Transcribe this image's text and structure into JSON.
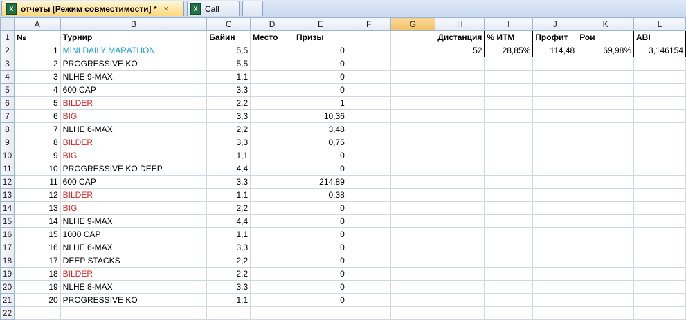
{
  "tabs": [
    {
      "label": "отчеты  [Режим совместимости] *",
      "close": "×",
      "icon": "excel-file-icon"
    },
    {
      "label": "Call",
      "icon": "excel-file-icon"
    },
    {
      "label": ""
    }
  ],
  "columns": [
    "A",
    "B",
    "C",
    "D",
    "E",
    "F",
    "G",
    "H",
    "I",
    "J",
    "K",
    "L"
  ],
  "row_numbers": [
    "1",
    "2",
    "3",
    "4",
    "5",
    "6",
    "7",
    "8",
    "9",
    "10",
    "11",
    "12",
    "13",
    "14",
    "15",
    "16",
    "17",
    "18",
    "19",
    "20",
    "21",
    "22"
  ],
  "header_row": {
    "A": "№",
    "B": "Турнир",
    "C": "Байин",
    "D": "Место",
    "E": "Призы",
    "H": "Дистанция",
    "I": "% ИТМ",
    "J": "Профит",
    "K": "Рои",
    "L": "ABI"
  },
  "stats": {
    "H": "52",
    "I": "28,85%",
    "J": "114,48",
    "K": "69,98%",
    "L": "3,146154"
  },
  "rows": [
    {
      "a": "1",
      "b": "MINI DAILY MARATHON",
      "c": "5,5",
      "d": "",
      "e": "0",
      "color": "blue"
    },
    {
      "a": "2",
      "b": "PROGRESSIVE KO",
      "c": "5,5",
      "d": "",
      "e": "0",
      "color": ""
    },
    {
      "a": "3",
      "b": "NLHE 9-MAX",
      "c": "1,1",
      "d": "",
      "e": "0",
      "color": ""
    },
    {
      "a": "4",
      "b": "600 CAP",
      "c": "3,3",
      "d": "",
      "e": "0",
      "color": ""
    },
    {
      "a": "5",
      "b": "BILDER",
      "c": "2,2",
      "d": "",
      "e": "1",
      "color": "red"
    },
    {
      "a": "6",
      "b": "BIG",
      "c": "3,3",
      "d": "",
      "e": "10,36",
      "color": "red"
    },
    {
      "a": "7",
      "b": "NLHE 6-MAX",
      "c": "2,2",
      "d": "",
      "e": "3,48",
      "color": ""
    },
    {
      "a": "8",
      "b": "BILDER",
      "c": "3,3",
      "d": "",
      "e": "0,75",
      "color": "red"
    },
    {
      "a": "9",
      "b": "BIG",
      "c": "1,1",
      "d": "",
      "e": "0",
      "color": "red"
    },
    {
      "a": "10",
      "b": "PROGRESSIVE KO DEEP",
      "c": "4,4",
      "d": "",
      "e": "0",
      "color": ""
    },
    {
      "a": "11",
      "b": "600 CAP",
      "c": "3,3",
      "d": "",
      "e": "214,89",
      "color": ""
    },
    {
      "a": "12",
      "b": "BILDER",
      "c": "1,1",
      "d": "",
      "e": "0,38",
      "color": "red"
    },
    {
      "a": "13",
      "b": "BIG",
      "c": "2,2",
      "d": "",
      "e": "0",
      "color": "red"
    },
    {
      "a": "14",
      "b": "NLHE 9-MAX",
      "c": "4,4",
      "d": "",
      "e": "0",
      "color": ""
    },
    {
      "a": "15",
      "b": "1000 CAP",
      "c": "1,1",
      "d": "",
      "e": "0",
      "color": ""
    },
    {
      "a": "16",
      "b": "NLHE 6-MAX",
      "c": "3,3",
      "d": "",
      "e": "0",
      "color": ""
    },
    {
      "a": "17",
      "b": "DEEP STACKS",
      "c": "2,2",
      "d": "",
      "e": "0",
      "color": ""
    },
    {
      "a": "18",
      "b": "BILDER",
      "c": "2,2",
      "d": "",
      "e": "0",
      "color": "red"
    },
    {
      "a": "19",
      "b": "NLHE 8-MAX",
      "c": "3,3",
      "d": "",
      "e": "0",
      "color": ""
    },
    {
      "a": "20",
      "b": "PROGRESSIVE KO",
      "c": "1,1",
      "d": "",
      "e": "0",
      "color": ""
    }
  ],
  "colors": {
    "link_blue": "#1ba2d6",
    "red": "#e02020",
    "header_bg": "#e4ebf5",
    "selected_header": "#f1c15f"
  }
}
